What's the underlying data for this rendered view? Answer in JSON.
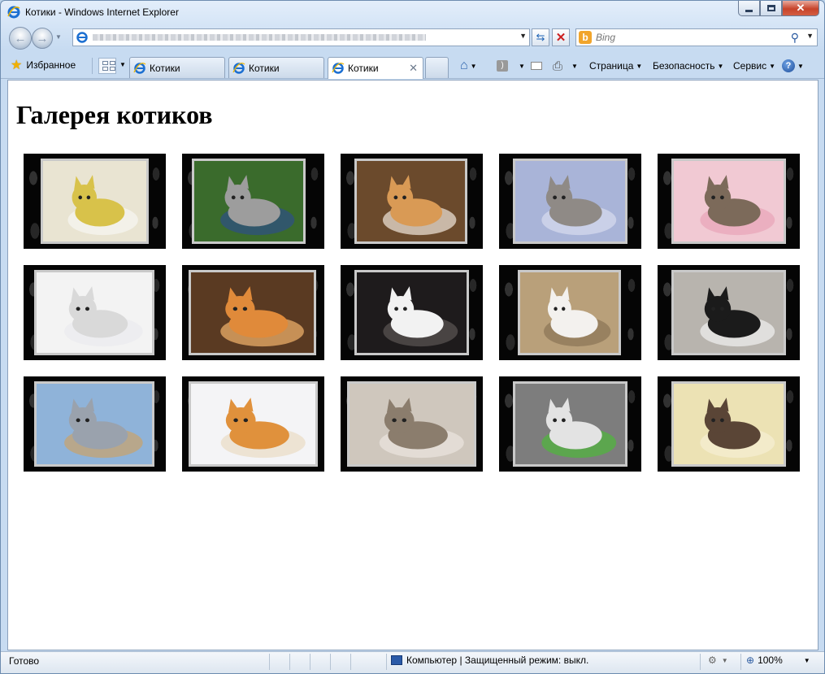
{
  "window": {
    "title": "Котики - Windows Internet Explorer"
  },
  "navigation": {
    "search_placeholder": "Bing"
  },
  "command_bar": {
    "favorites_label": "Избранное",
    "tabs": [
      {
        "label": "Котики",
        "active": false
      },
      {
        "label": "Котики",
        "active": false
      },
      {
        "label": "Котики",
        "active": true
      }
    ],
    "page_menu": "Страница",
    "safety_menu": "Безопасность",
    "tools_menu": "Сервис"
  },
  "page": {
    "heading": "Галерея котиков",
    "gallery": [
      {
        "icon": "kitten-in-basket-photo",
        "palette": [
          "#e9e4d2",
          "#d8c24a",
          "#f7f7f2"
        ]
      },
      {
        "icon": "tabby-kitten-photo",
        "palette": [
          "#3a6b2c",
          "#9d9d9d",
          "#2e4f86"
        ]
      },
      {
        "icon": "fluffy-ginger-cat-photo",
        "palette": [
          "#6b4a2c",
          "#d99a55",
          "#f1e7dc"
        ]
      },
      {
        "icon": "cat-on-back-photo",
        "palette": [
          "#a9b4d8",
          "#8f8a86",
          "#d9dcef"
        ]
      },
      {
        "icon": "kitten-in-pink-bag-photo",
        "palette": [
          "#f1c9d3",
          "#7c6a5a",
          "#e8a4b8"
        ]
      },
      {
        "icon": "white-cat-odd-eyes-photo",
        "palette": [
          "#f3f3f3",
          "#d9d9d9",
          "#e9e9ee"
        ]
      },
      {
        "icon": "ginger-kitten-face-photo",
        "palette": [
          "#5a3a22",
          "#e08a3a",
          "#f3b56c"
        ]
      },
      {
        "icon": "white-kitten-dark-bg-photo",
        "palette": [
          "#1e1b1c",
          "#f2f2f2",
          "#5b5654"
        ]
      },
      {
        "icon": "white-cat-on-blanket-photo",
        "palette": [
          "#b9a07a",
          "#f3f1ee",
          "#8a7355"
        ]
      },
      {
        "icon": "black-white-cat-photo",
        "palette": [
          "#b8b4ae",
          "#1b1b1b",
          "#f1f1f1"
        ]
      },
      {
        "icon": "grey-kitten-swing-photo",
        "palette": [
          "#8fb3d9",
          "#9aa2ad",
          "#c9a36a"
        ]
      },
      {
        "icon": "kitten-with-yarn-photo",
        "palette": [
          "#f4f4f6",
          "#e0913c",
          "#e9dcc4"
        ]
      },
      {
        "icon": "tabby-cat-lying-photo",
        "palette": [
          "#cfc7bd",
          "#8b7d6d",
          "#ebe6df"
        ]
      },
      {
        "icon": "blue-eyed-kitten-photo",
        "palette": [
          "#7d7d7d",
          "#e3e3e3",
          "#4fb83a"
        ]
      },
      {
        "icon": "siamese-kitten-sleeping-photo",
        "palette": [
          "#ece2b4",
          "#5a4536",
          "#f6f0d3"
        ]
      }
    ]
  },
  "status_bar": {
    "status": "Готово",
    "zone": "Компьютер | Защищенный режим: выкл.",
    "zoom": "100%"
  }
}
